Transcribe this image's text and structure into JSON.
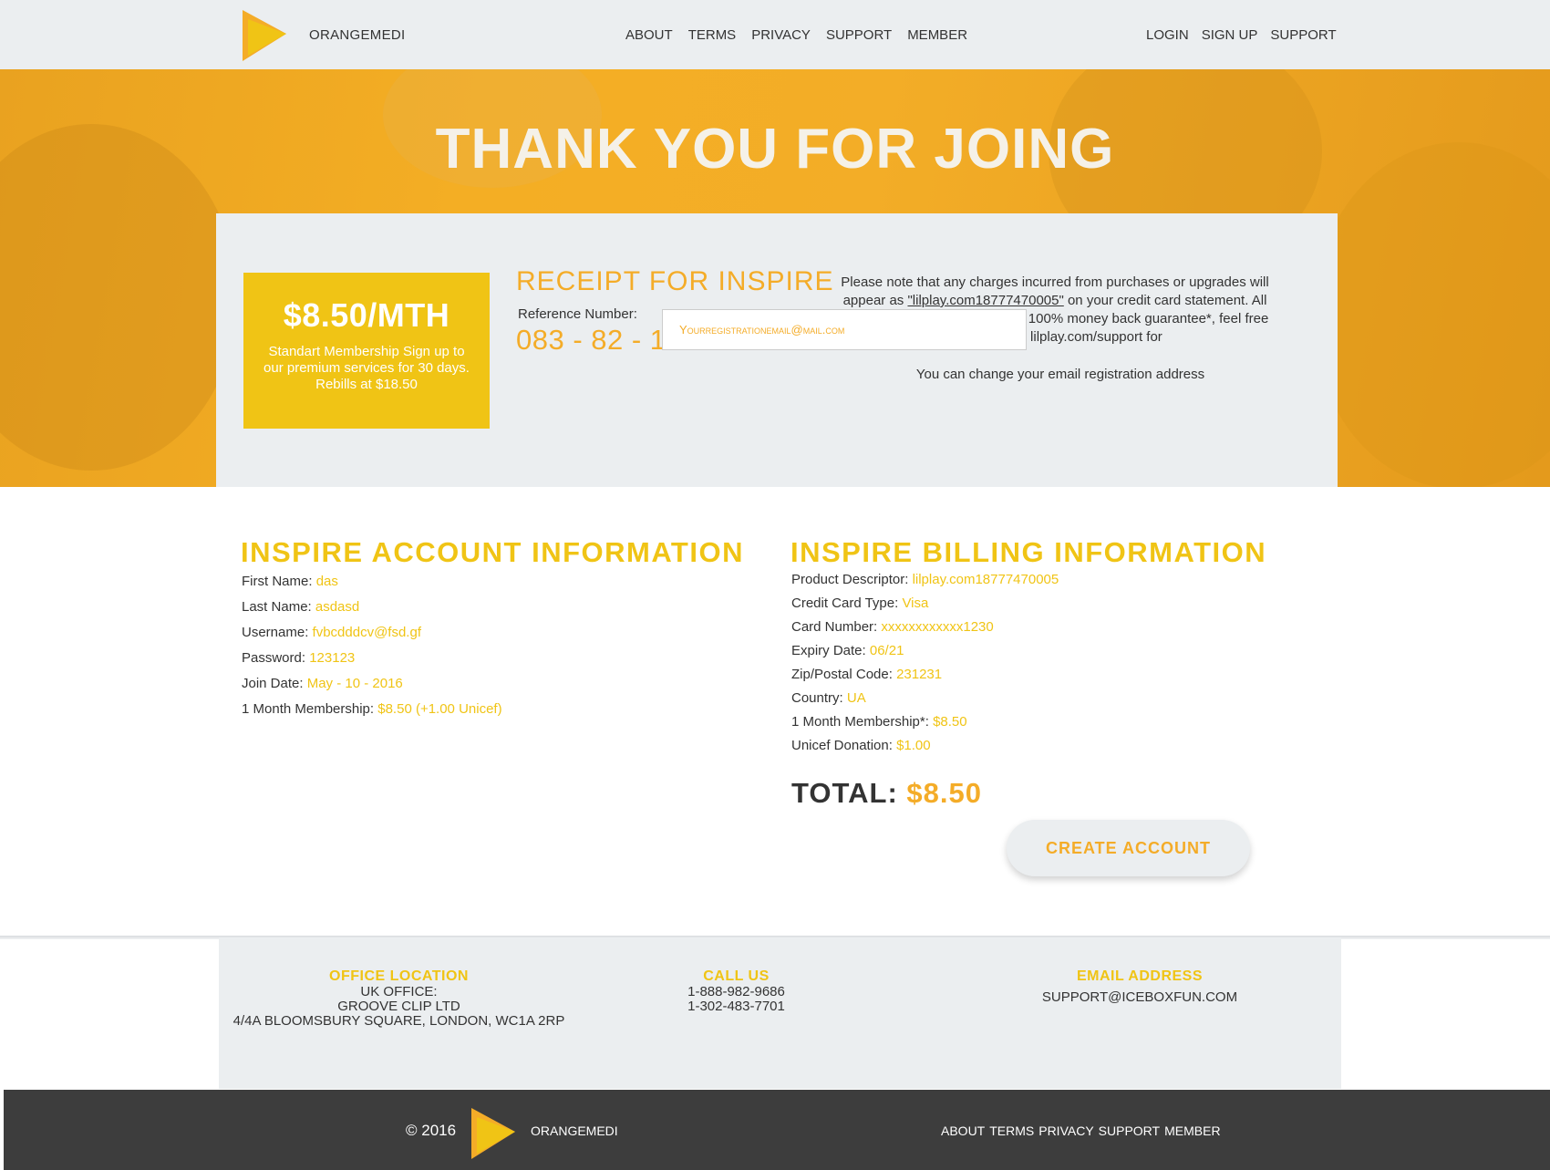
{
  "header": {
    "brand": "ORANGEMEDI",
    "nav_main": [
      "ABOUT",
      "TERMS",
      "PRIVACY",
      "SUPPORT",
      "MEMBER"
    ],
    "nav_right": [
      "LOGIN",
      "SIGN UP",
      "SUPPORT"
    ]
  },
  "hero": {
    "title": "THANK YOU FOR JOING"
  },
  "plan": {
    "price": "$8.50/MTH",
    "description": "Standart Membership Sign up to our premium services for 30 days. Rebills at $18.50"
  },
  "receipt": {
    "title": "RECEIPT FOR INSPIRE",
    "reference_label": "Reference Number:",
    "reference_number": "083 - 82 - 1399440894"
  },
  "note": {
    "text_before": "Please note that any charges incurred from purchases or upgrades will appear as ",
    "descriptor": "\"lilplay.com18777470005\"",
    "text_after": " on your credit card statement. All our users are protected by our 100% money back guarantee*, feel free to call or visit lilplay.com/support for",
    "change_email_label": "You can change your email registration address",
    "email_placeholder": "Yourregistrationemail@mail.com"
  },
  "account": {
    "title": "INSPIRE  ACCOUNT INFORMATION",
    "rows": [
      {
        "label": "First Name:",
        "value": "das"
      },
      {
        "label": "Last Name:",
        "value": "asdasd"
      },
      {
        "label": "Username:",
        "value": "fvbcdddcv@fsd.gf"
      },
      {
        "label": "Password:",
        "value": "123123"
      },
      {
        "label": "Join Date:",
        "value": "May - 10 - 2016"
      },
      {
        "label": "1 Month Membership:",
        "value": "$8.50 (+1.00 Unicef)"
      }
    ]
  },
  "billing": {
    "title": "INSPIRE  BILLING INFORMATION",
    "rows": [
      {
        "label": "Product Descriptor:",
        "value": "lilplay.com18777470005"
      },
      {
        "label": "Credit Card Type:",
        "value": "Visa"
      },
      {
        "label": "Card Number:",
        "value": "xxxxxxxxxxxx1230"
      },
      {
        "label": "Expiry Date:",
        "value": "06/21"
      },
      {
        "label": "Zip/Postal Code:",
        "value": "231231"
      },
      {
        "label": "Country:",
        "value": "UA"
      },
      {
        "label": "1 Month Membership*:",
        "value": "$8.50"
      },
      {
        "label": "Unicef Donation:",
        "value": "$1.00"
      }
    ],
    "total_label": "TOTAL:",
    "total_value": "$8.50",
    "create_button": "CREATE ACCOUNT"
  },
  "contact": {
    "office_head": "OFFICE LOCATION",
    "office_lines": [
      "UK OFFICE:",
      "GROOVE CLIP LTD",
      "4/4A BLOOMSBURY SQUARE, LONDON, WC1A 2RP"
    ],
    "call_head": "CALL US",
    "call_lines": [
      "1-888-982-9686",
      "1-302-483-7701"
    ],
    "email_head": "EMAIL ADDRESS",
    "email": "SUPPORT@ICEBOXFUN.COM"
  },
  "footer": {
    "copyright": "© 2016",
    "brand": "ORANGEMEDI",
    "nav": [
      "ABOUT",
      "TERMS",
      "PRIVACY",
      "SUPPORT",
      "MEMBER"
    ]
  },
  "colors": {
    "accent_orange": "#f4ac28",
    "accent_yellow": "#f0c415",
    "panel_gray": "#ebeef0",
    "footer_dark": "#3d3d3d"
  }
}
